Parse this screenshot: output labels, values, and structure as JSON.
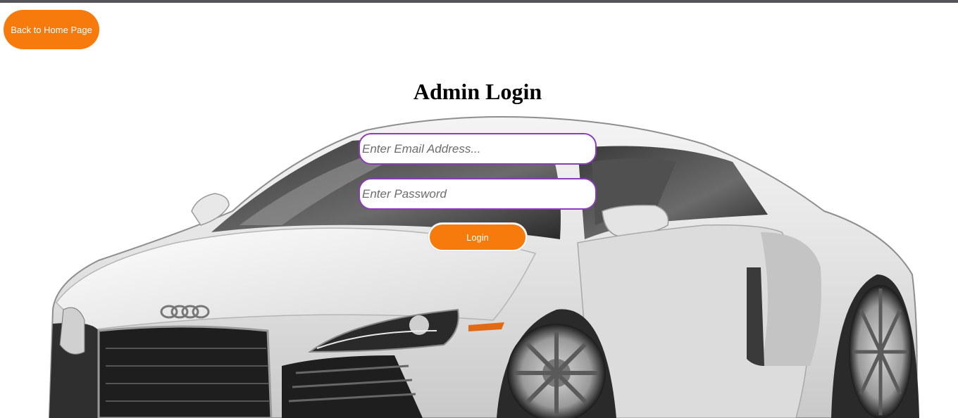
{
  "nav": {
    "back_label": "Back to Home Page"
  },
  "login": {
    "title": "Admin Login",
    "email_placeholder": "Enter Email Address...",
    "password_placeholder": "Enter Password",
    "submit_label": "Login"
  },
  "colors": {
    "accent": "#f67a0c",
    "input_border": "#8b3cb8",
    "top_strip": "#56565a"
  },
  "background": {
    "image": "white-sports-car"
  }
}
